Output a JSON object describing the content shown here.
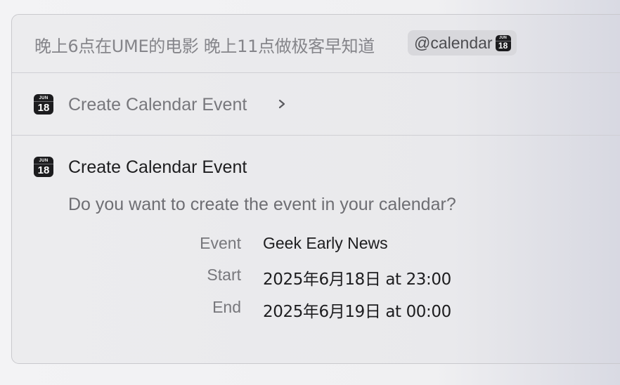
{
  "query": {
    "text": "晚上6点在UME的电影 晚上11点做极客早知道",
    "mention": {
      "label": "@calendar",
      "icon": "calendar-icon"
    }
  },
  "calendar_icon": {
    "month": "JUN",
    "day": "18"
  },
  "suggestion": {
    "label": "Create Calendar Event",
    "icon": "calendar-icon",
    "chevron_icon": "chevron-right-icon"
  },
  "detail": {
    "title": "Create Calendar Event",
    "icon": "calendar-icon",
    "question": "Do you want to create the event in your calendar?",
    "fields": [
      {
        "label": "Event",
        "value": "Geek Early News"
      },
      {
        "label": "Start",
        "value": "2025年6月18日 at 23:00"
      },
      {
        "label": "End",
        "value": "2025年6月19日 at 00:00"
      }
    ]
  },
  "colors": {
    "text_primary": "#1d1d1f",
    "text_secondary": "#77777c",
    "chip_background": "#d8d8dc",
    "icon_background": "#1c1c1e"
  }
}
